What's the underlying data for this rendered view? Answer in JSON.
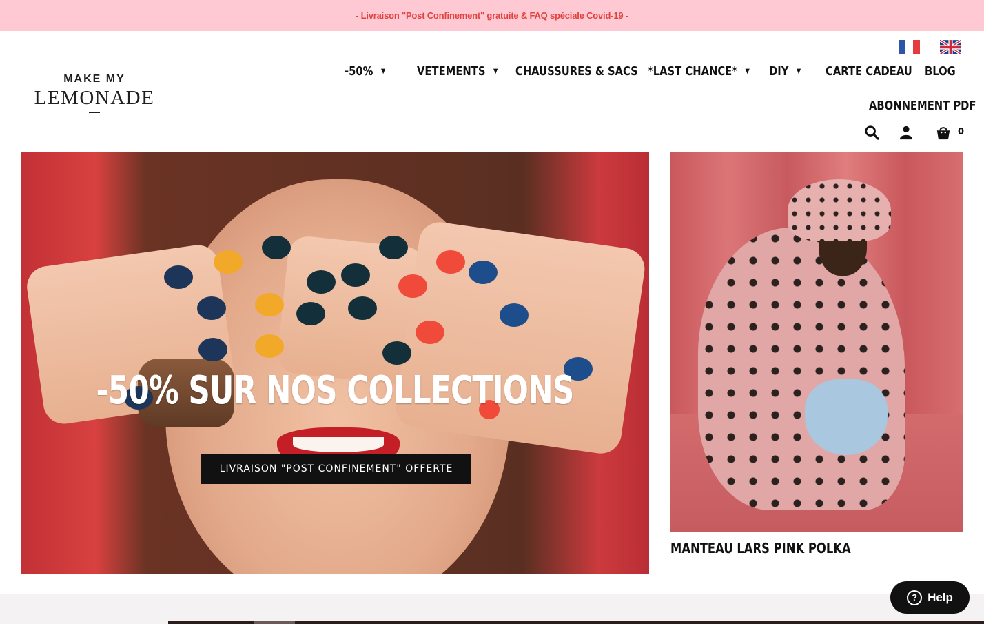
{
  "announcement": {
    "text": "- Livraison \"Post Confinement\" gratuite & FAQ spéciale Covid-19 -",
    "color": "#e0433f",
    "background": "#ffc9d3"
  },
  "logo": {
    "top": "MAKE MY",
    "main": "LEMONADE"
  },
  "languages": [
    {
      "name": "fr-flag-icon"
    },
    {
      "name": "uk-flag-icon"
    }
  ],
  "nav": {
    "items": [
      {
        "label": "-50%",
        "has_dropdown": true
      },
      {
        "label": "VETEMENTS",
        "has_dropdown": true
      },
      {
        "label": "CHAUSSURES & SACS",
        "has_dropdown": false
      },
      {
        "label": "*LAST CHANCE*",
        "has_dropdown": true
      },
      {
        "label": "DIY",
        "has_dropdown": true
      },
      {
        "label": "CARTE CADEAU",
        "has_dropdown": false
      },
      {
        "label": "BLOG",
        "has_dropdown": false
      },
      {
        "label": "ABONNEMENT PDF",
        "has_dropdown": false
      }
    ],
    "caret": "▼"
  },
  "utility": {
    "icons": [
      "search-icon",
      "account-icon",
      "cart-icon"
    ],
    "cart_count": "0"
  },
  "hero": {
    "title": "-50% SUR NOS COLLECTIONS",
    "button_label": "LIVRAISON \"POST CONFINEMENT\" OFFERTE"
  },
  "side_product": {
    "caption": "MANTEAU LARS PINK POLKA"
  },
  "help": {
    "label": "Help",
    "icon_glyph": "?"
  }
}
